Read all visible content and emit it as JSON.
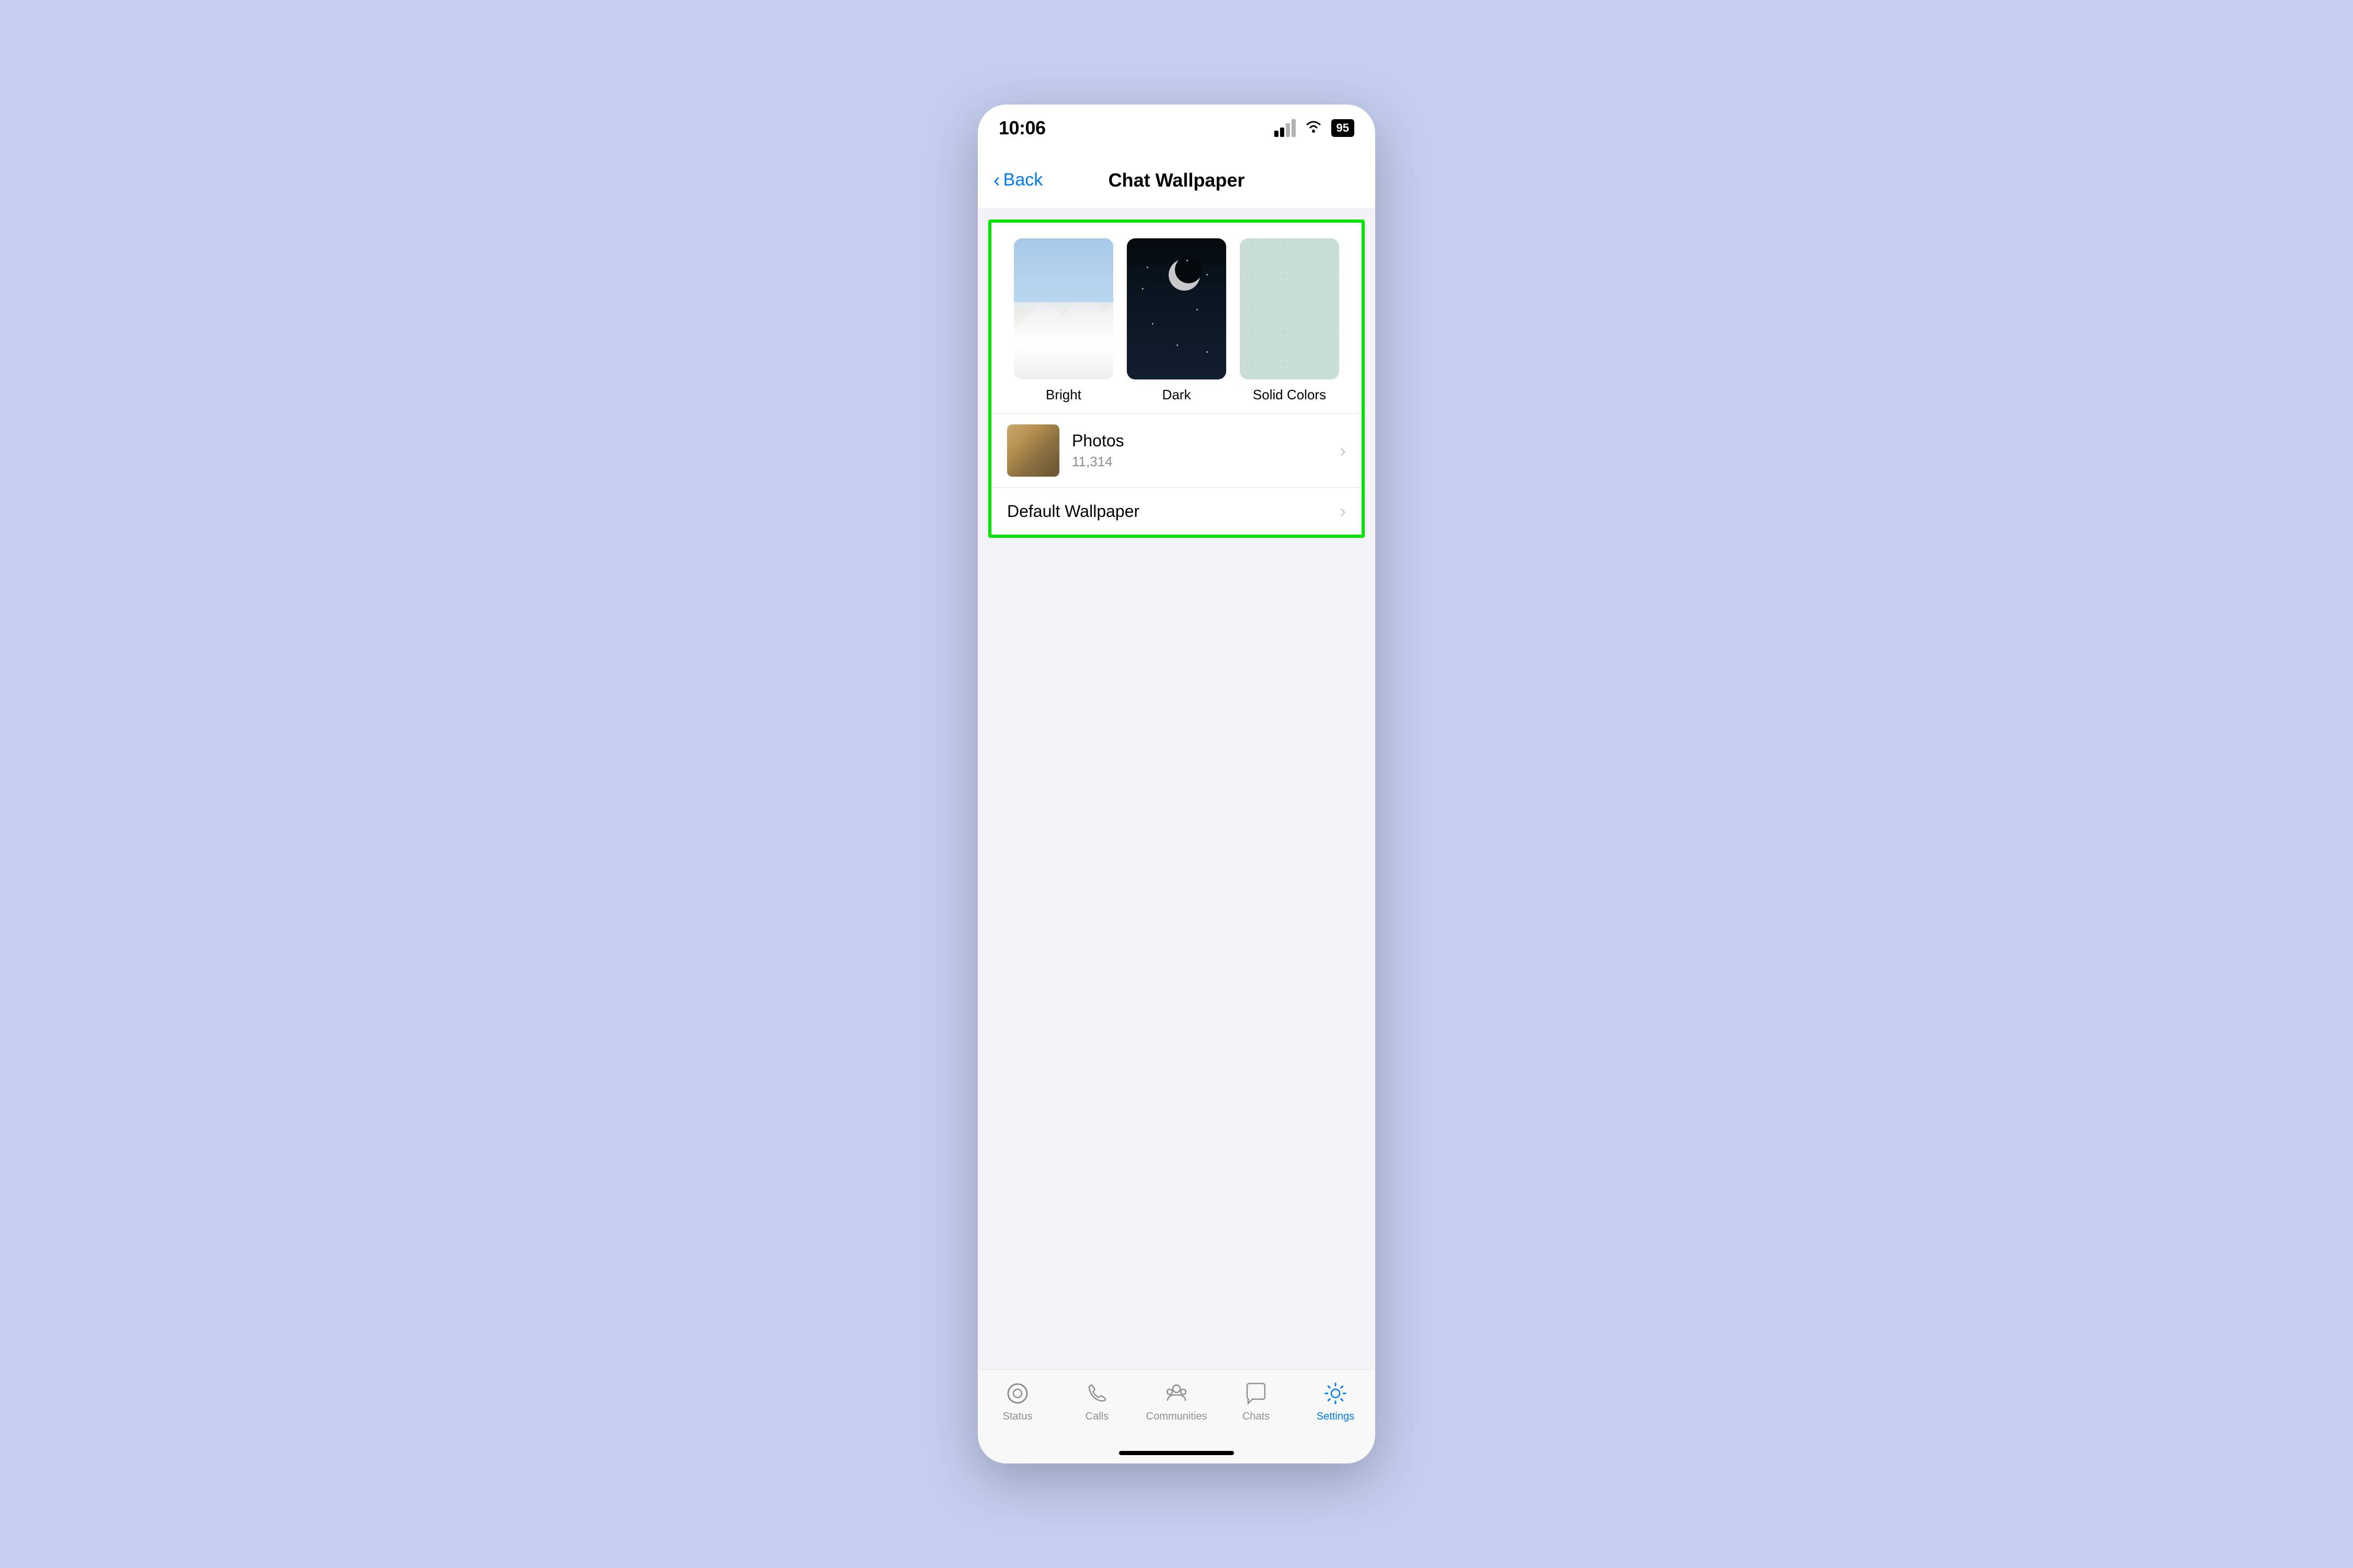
{
  "statusBar": {
    "time": "10:06",
    "battery": "95"
  },
  "navBar": {
    "backLabel": "Back",
    "title": "Chat Wallpaper"
  },
  "wallpaperOptions": [
    {
      "id": "bright",
      "label": "Bright",
      "type": "bright"
    },
    {
      "id": "dark",
      "label": "Dark",
      "type": "dark"
    },
    {
      "id": "solid",
      "label": "Solid Colors",
      "type": "solid"
    }
  ],
  "listItems": [
    {
      "id": "photos",
      "title": "Photos",
      "subtitle": "11,314",
      "hasThumb": true,
      "hasChevron": true
    },
    {
      "id": "default",
      "title": "Default Wallpaper",
      "subtitle": "",
      "hasThumb": false,
      "hasChevron": true
    }
  ],
  "tabBar": {
    "items": [
      {
        "id": "status",
        "label": "Status",
        "active": false
      },
      {
        "id": "calls",
        "label": "Calls",
        "active": false
      },
      {
        "id": "communities",
        "label": "Communities",
        "active": false
      },
      {
        "id": "chats",
        "label": "Chats",
        "active": false
      },
      {
        "id": "settings",
        "label": "Settings",
        "active": true
      }
    ]
  }
}
